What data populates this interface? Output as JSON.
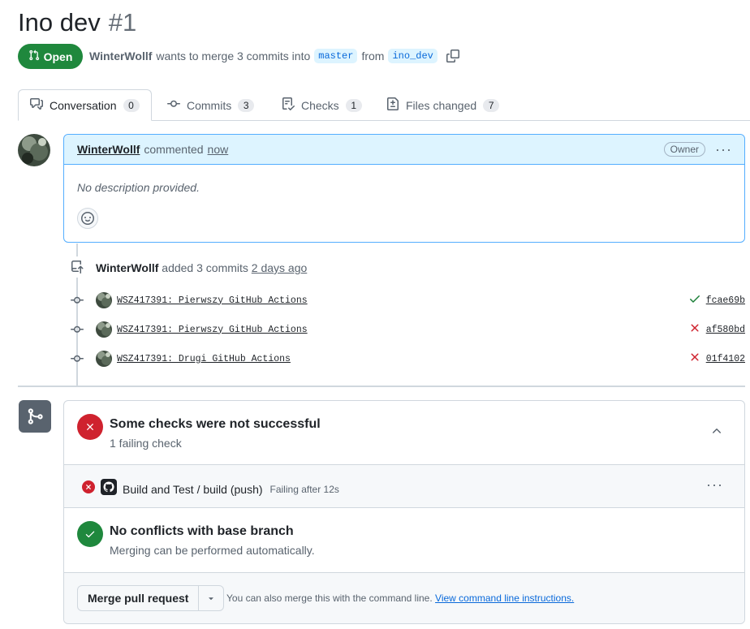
{
  "header": {
    "title": "Ino dev",
    "number": "#1",
    "state_label": "Open",
    "author": "WinterWollf",
    "merge_text": "wants to merge 3 commits into",
    "base_branch": "master",
    "from_text": "from",
    "head_branch": "ino_dev"
  },
  "tabs": [
    {
      "label": "Conversation",
      "count": "0"
    },
    {
      "label": "Commits",
      "count": "3"
    },
    {
      "label": "Checks",
      "count": "1"
    },
    {
      "label": "Files changed",
      "count": "7"
    }
  ],
  "comment": {
    "author": "WinterWollf",
    "verb": "commented",
    "time": "now",
    "badge": "Owner",
    "body": "No description provided."
  },
  "push_event": {
    "author": "WinterWollf",
    "text": "added 3 commits",
    "time": "2 days ago"
  },
  "commits": [
    {
      "message": "WSZ417391: Pierwszy GitHub Actions",
      "status": "success",
      "sha": "fcae69b"
    },
    {
      "message": "WSZ417391: Pierwszy GitHub Actions",
      "status": "failure",
      "sha": "af580bd"
    },
    {
      "message": "WSZ417391: Drugi GitHub Actions",
      "status": "failure",
      "sha": "01f4102"
    }
  ],
  "merge_box": {
    "checks_title": "Some checks were not successful",
    "checks_subtitle": "1 failing check",
    "check_name": "Build and Test / build (push)",
    "check_detail": "Failing after 12s",
    "conflicts_title": "No conflicts with base branch",
    "conflicts_subtitle": "Merging can be performed automatically.",
    "merge_button": "Merge pull request",
    "hint_text": "You can also merge this with the command line.",
    "hint_link": "View command line instructions."
  },
  "colors": {
    "open_green": "#1f883d",
    "fail_red": "#cf222e",
    "link_blue": "#0969da",
    "comment_blue": "#ddf4ff"
  }
}
